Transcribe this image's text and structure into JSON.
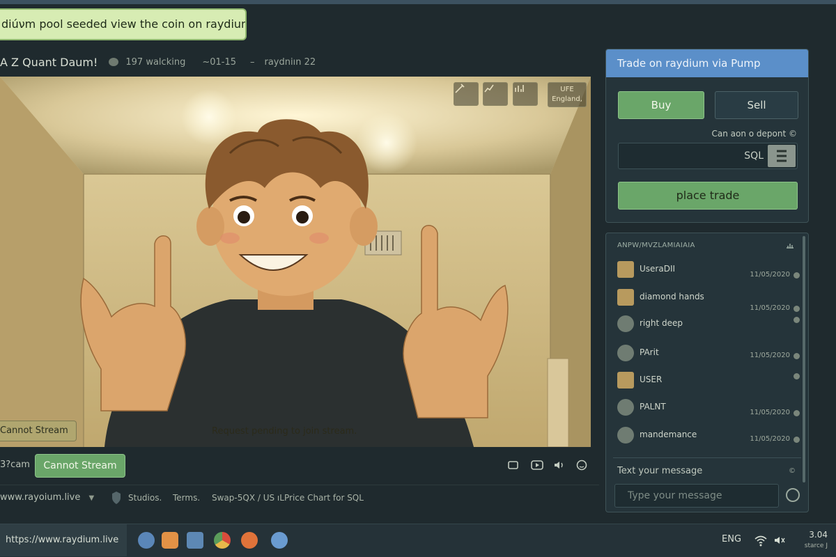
{
  "banner": {
    "text": "diúνm pool seeded view the coin on raydium live"
  },
  "stream": {
    "title": "A Z Quant Daum!",
    "watching": "197  walcking",
    "time": "~01-15",
    "separator": "–",
    "channel": "raydniın  22",
    "location_line1": "UFE",
    "location_line2": "England,",
    "overlay_status": "Cannot Stream",
    "pending_text": "Request pending to join stream."
  },
  "controls": {
    "cam_label": "3?cam",
    "cannot_stream_button": "Cannot Stream"
  },
  "footer": {
    "url": "www.rayoium.live",
    "links": [
      "Studios.",
      "Terms.",
      "Swap-5QX / US ıL",
      "Price Chart for SQL"
    ]
  },
  "trade": {
    "title": "Trade on raydium via Pump",
    "buy_label": "Buy",
    "sell_label": "Sell",
    "deposit_text": "Can aon o depont ©",
    "currency": "SQL",
    "place_label": "place trade"
  },
  "chat": {
    "header": "ANPW/MVZLAMIAIAIA",
    "messages": [
      {
        "name": "UseraDII",
        "time": "11/05/2020",
        "avatar": "square"
      },
      {
        "name": "diamond hands",
        "time": "11/05/2020",
        "avatar": "square"
      },
      {
        "name": "right deep",
        "time": "",
        "avatar": "round"
      },
      {
        "name": "PArit",
        "time": "11/05/2020",
        "avatar": "round"
      },
      {
        "name": "USER",
        "time": "",
        "avatar": "square"
      },
      {
        "name": "PALNT",
        "time": "11/05/2020",
        "avatar": "round"
      },
      {
        "name": "mandemance",
        "time": "11/05/2020",
        "avatar": "round"
      }
    ],
    "text_label": "Text your message",
    "text_icon": "©",
    "input_placeholder": "Type your message"
  },
  "taskbar": {
    "url": "https://www.raydium.live",
    "lang": "ENG",
    "time": "3.04",
    "date": "starce J"
  },
  "colors": {
    "accent_green": "#6aa669",
    "accent_blue": "#5b8fc9",
    "panel": "#25343a",
    "banner": "#d7ecb3"
  }
}
